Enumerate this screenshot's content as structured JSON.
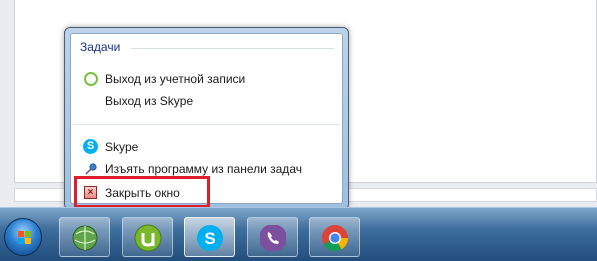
{
  "jump_list": {
    "section_title": "Задачи",
    "tasks": [
      {
        "label": "Выход из учетной записи",
        "icon": "skype-outline-icon"
      },
      {
        "label": "Выход из Skype",
        "icon": ""
      }
    ],
    "app_items": [
      {
        "label": "Skype",
        "icon": "skype-icon"
      },
      {
        "label": "Изъять программу из панели задач",
        "icon": "unpin-icon"
      },
      {
        "label": "Закрыть окно",
        "icon": "close-window-icon",
        "highlighted": true
      }
    ]
  },
  "taskbar": {
    "buttons": [
      {
        "name": "start",
        "icon": "windows-logo-icon"
      },
      {
        "name": "network-app",
        "icon": "globe-icon"
      },
      {
        "name": "utorrent",
        "icon": "utorrent-icon"
      },
      {
        "name": "skype",
        "icon": "skype-icon",
        "active": true
      },
      {
        "name": "viber",
        "icon": "viber-icon"
      },
      {
        "name": "chrome",
        "icon": "chrome-icon"
      }
    ]
  },
  "colors": {
    "highlight_border": "#e01d2a",
    "section_title": "#1e3287",
    "skype_blue": "#00aff0",
    "viber_purple": "#7b519d",
    "utorrent_green": "#78b82a"
  }
}
